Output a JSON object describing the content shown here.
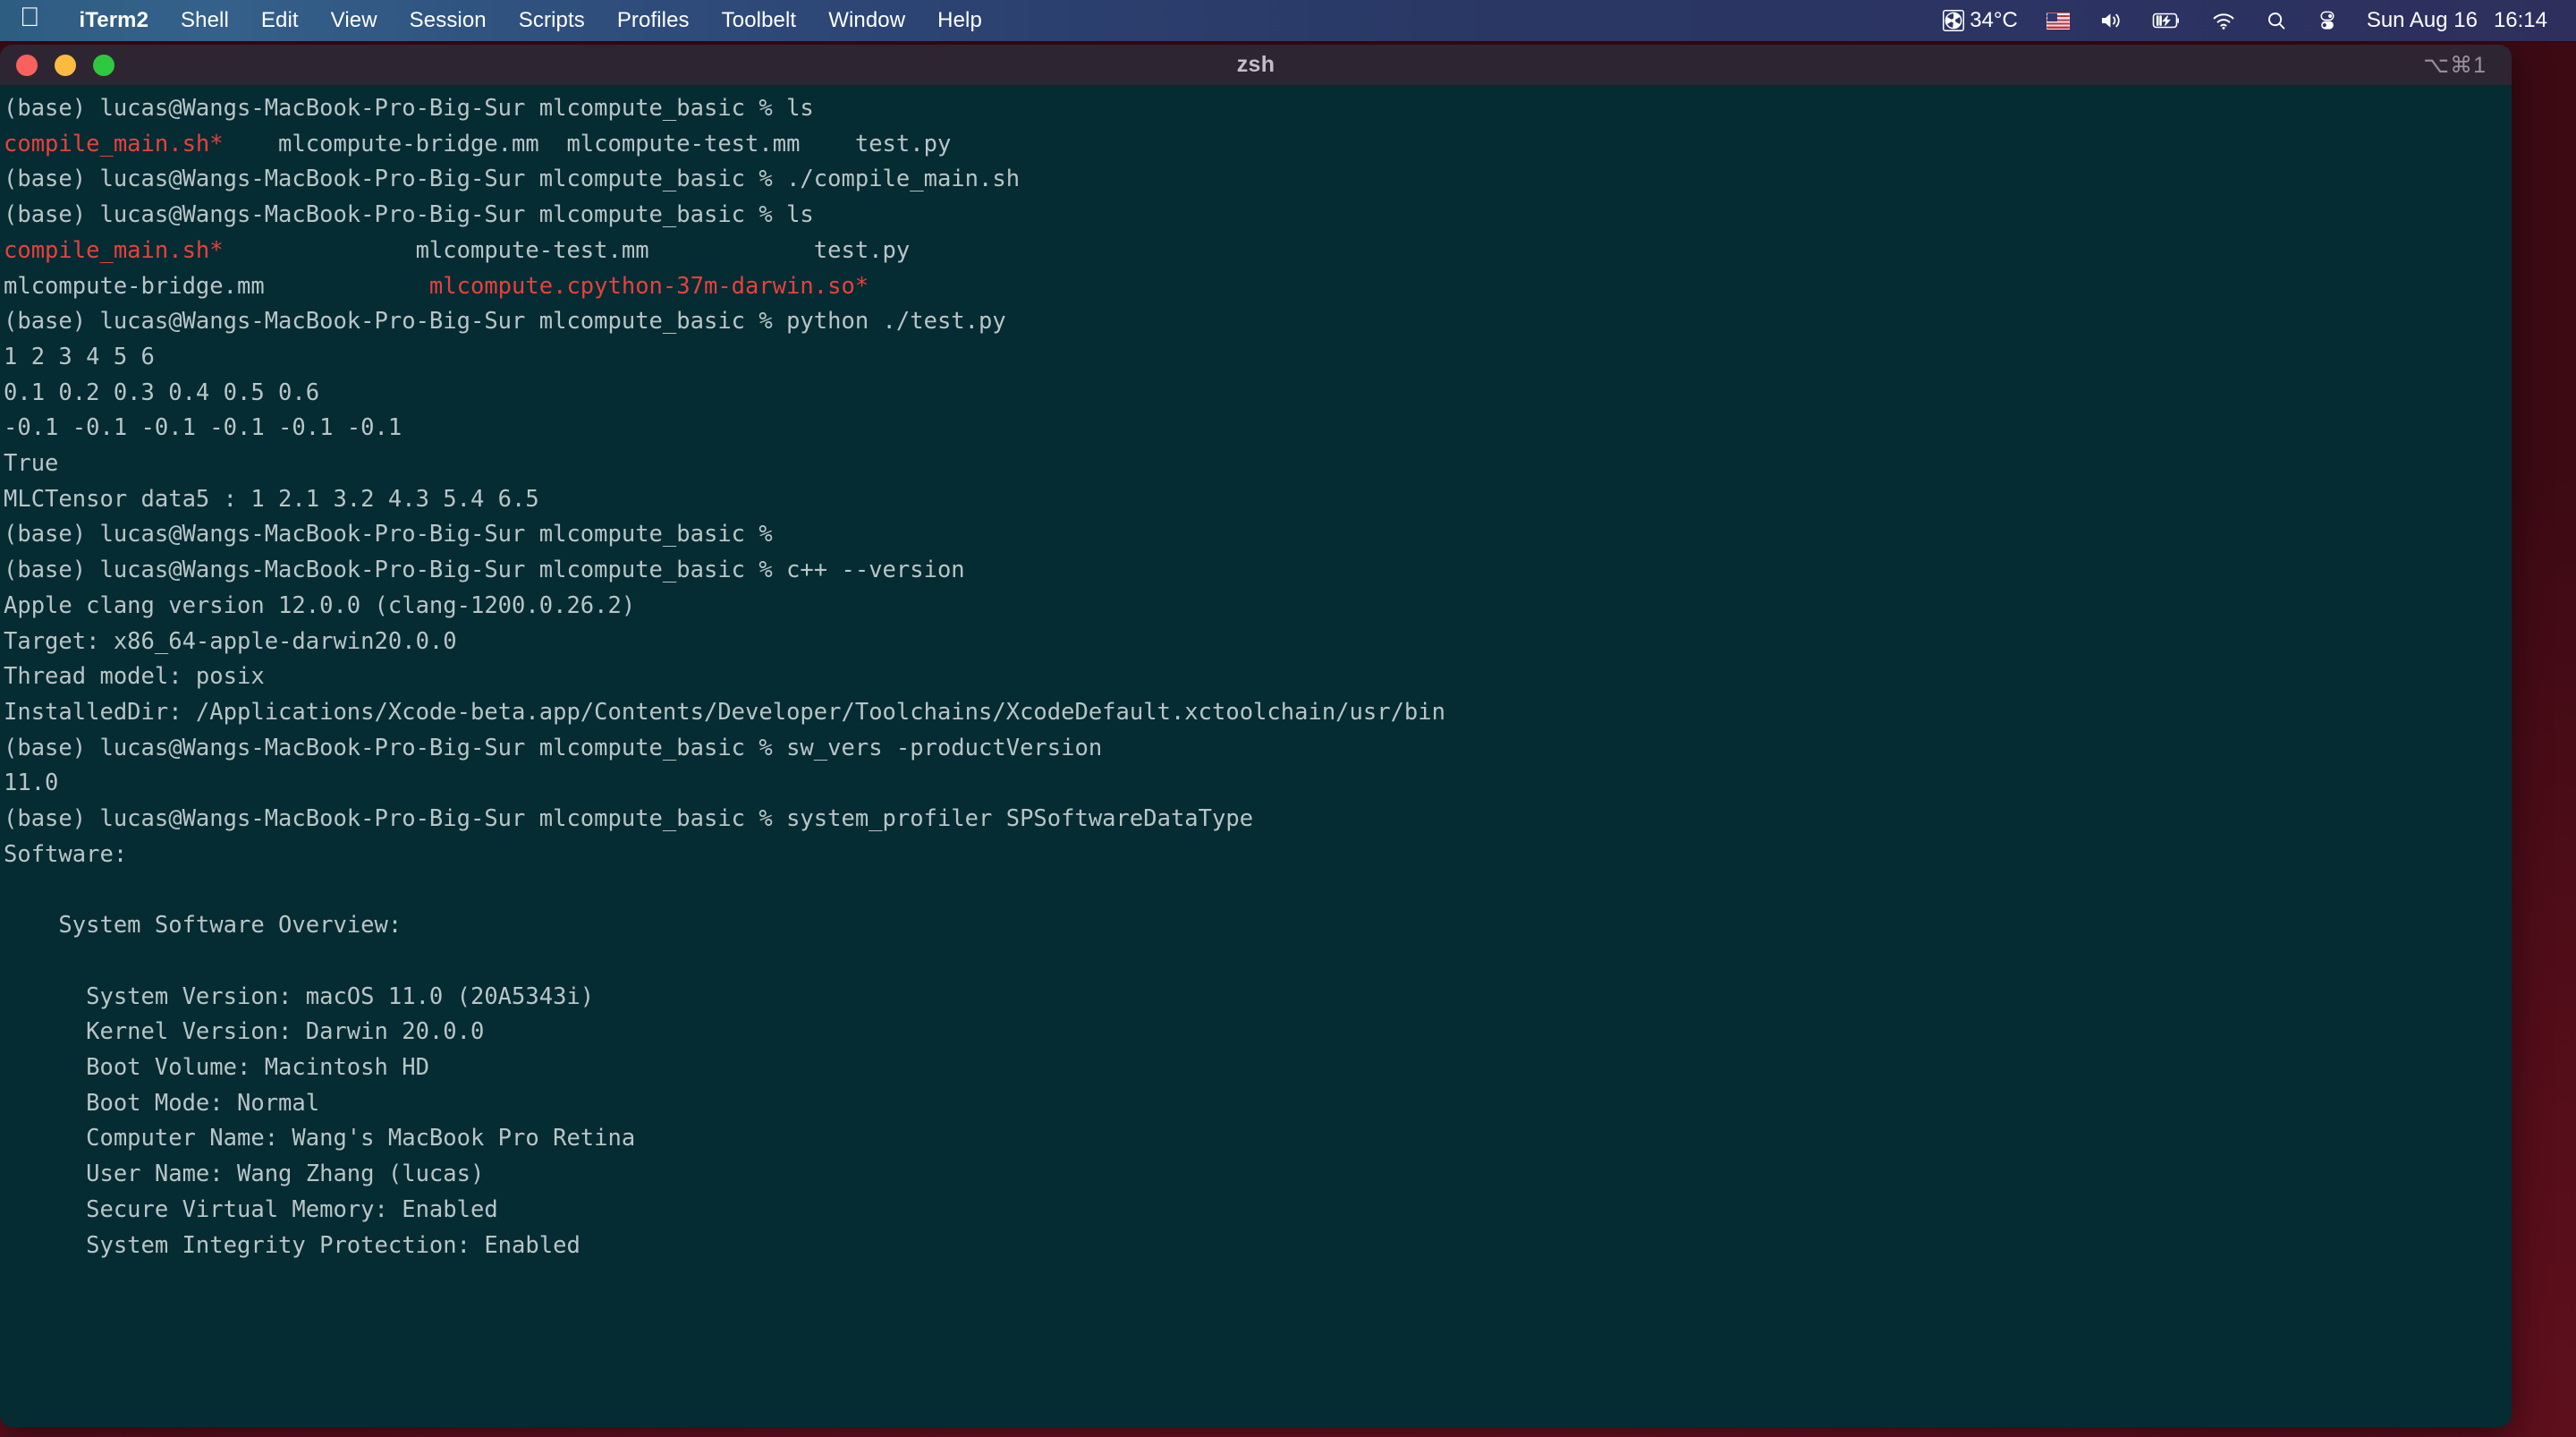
{
  "menubar": {
    "apple_icon": "apple-logo-icon",
    "items": [
      {
        "label": "iTerm2",
        "bold": true
      },
      {
        "label": "Shell"
      },
      {
        "label": "Edit"
      },
      {
        "label": "View"
      },
      {
        "label": "Session"
      },
      {
        "label": "Scripts"
      },
      {
        "label": "Profiles"
      },
      {
        "label": "Toolbelt"
      },
      {
        "label": "Window"
      },
      {
        "label": "Help"
      }
    ],
    "status": {
      "temperature": "34°C",
      "fan_icon": "fan-icon",
      "flag_icon": "us-flag-input-icon",
      "volume_icon": "speaker-volume-icon",
      "battery_icon": "battery-charging-icon",
      "wifi_icon": "wifi-icon",
      "search_icon": "spotlight-search-icon",
      "control_center_icon": "control-center-icon",
      "date": "Sun Aug 16",
      "time": "16:14"
    }
  },
  "window": {
    "title": "zsh",
    "shortcut": "⌥⌘1",
    "traffic_lights": [
      "close-button",
      "minimize-button",
      "zoom-button"
    ],
    "colors": {
      "background": "#052b33",
      "titlebar": "#2e2533",
      "foreground": "#b9c5c6",
      "red": "#e8413a"
    }
  },
  "terminal": {
    "lines": [
      [
        {
          "t": "(base) lucas@Wangs-MacBook-Pro-Big-Sur mlcompute_basic % ls",
          "c": "def"
        }
      ],
      [
        {
          "t": "compile_main.sh*",
          "c": "red"
        },
        {
          "t": "    mlcompute-bridge.mm  mlcompute-test.mm    test.py",
          "c": "def"
        }
      ],
      [
        {
          "t": "(base) lucas@Wangs-MacBook-Pro-Big-Sur mlcompute_basic % ./compile_main.sh",
          "c": "def"
        }
      ],
      [
        {
          "t": "(base) lucas@Wangs-MacBook-Pro-Big-Sur mlcompute_basic % ls",
          "c": "def"
        }
      ],
      [
        {
          "t": "compile_main.sh*",
          "c": "red"
        },
        {
          "t": "              mlcompute-test.mm            test.py",
          "c": "def"
        }
      ],
      [
        {
          "t": "mlcompute-bridge.mm            ",
          "c": "def"
        },
        {
          "t": "mlcompute.cpython-37m-darwin.so*",
          "c": "red"
        }
      ],
      [
        {
          "t": "(base) lucas@Wangs-MacBook-Pro-Big-Sur mlcompute_basic % python ./test.py",
          "c": "def"
        }
      ],
      [
        {
          "t": "1 2 3 4 5 6",
          "c": "def"
        }
      ],
      [
        {
          "t": "0.1 0.2 0.3 0.4 0.5 0.6",
          "c": "def"
        }
      ],
      [
        {
          "t": "-0.1 -0.1 -0.1 -0.1 -0.1 -0.1",
          "c": "def"
        }
      ],
      [
        {
          "t": "True",
          "c": "def"
        }
      ],
      [
        {
          "t": "MLCTensor data5 : 1 2.1 3.2 4.3 5.4 6.5",
          "c": "def"
        }
      ],
      [
        {
          "t": "(base) lucas@Wangs-MacBook-Pro-Big-Sur mlcompute_basic %",
          "c": "def"
        }
      ],
      [
        {
          "t": "(base) lucas@Wangs-MacBook-Pro-Big-Sur mlcompute_basic % c++ --version",
          "c": "def"
        }
      ],
      [
        {
          "t": "Apple clang version 12.0.0 (clang-1200.0.26.2)",
          "c": "def"
        }
      ],
      [
        {
          "t": "Target: x86_64-apple-darwin20.0.0",
          "c": "def"
        }
      ],
      [
        {
          "t": "Thread model: posix",
          "c": "def"
        }
      ],
      [
        {
          "t": "InstalledDir: /Applications/Xcode-beta.app/Contents/Developer/Toolchains/XcodeDefault.xctoolchain/usr/bin",
          "c": "def"
        }
      ],
      [
        {
          "t": "(base) lucas@Wangs-MacBook-Pro-Big-Sur mlcompute_basic % sw_vers -productVersion",
          "c": "def"
        }
      ],
      [
        {
          "t": "11.0",
          "c": "def"
        }
      ],
      [
        {
          "t": "(base) lucas@Wangs-MacBook-Pro-Big-Sur mlcompute_basic % system_profiler SPSoftwareDataType",
          "c": "def"
        }
      ],
      [
        {
          "t": "Software:",
          "c": "def"
        }
      ],
      [
        {
          "t": "",
          "c": "def"
        }
      ],
      [
        {
          "t": "    System Software Overview:",
          "c": "def"
        }
      ],
      [
        {
          "t": "",
          "c": "def"
        }
      ],
      [
        {
          "t": "      System Version: macOS 11.0 (20A5343i)",
          "c": "def"
        }
      ],
      [
        {
          "t": "      Kernel Version: Darwin 20.0.0",
          "c": "def"
        }
      ],
      [
        {
          "t": "      Boot Volume: Macintosh HD",
          "c": "def"
        }
      ],
      [
        {
          "t": "      Boot Mode: Normal",
          "c": "def"
        }
      ],
      [
        {
          "t": "      Computer Name: Wang's MacBook Pro Retina",
          "c": "def"
        }
      ],
      [
        {
          "t": "      User Name: Wang Zhang (lucas)",
          "c": "def"
        }
      ],
      [
        {
          "t": "      Secure Virtual Memory: Enabled",
          "c": "def"
        }
      ],
      [
        {
          "t": "      System Integrity Protection: Enabled",
          "c": "def"
        }
      ]
    ]
  }
}
